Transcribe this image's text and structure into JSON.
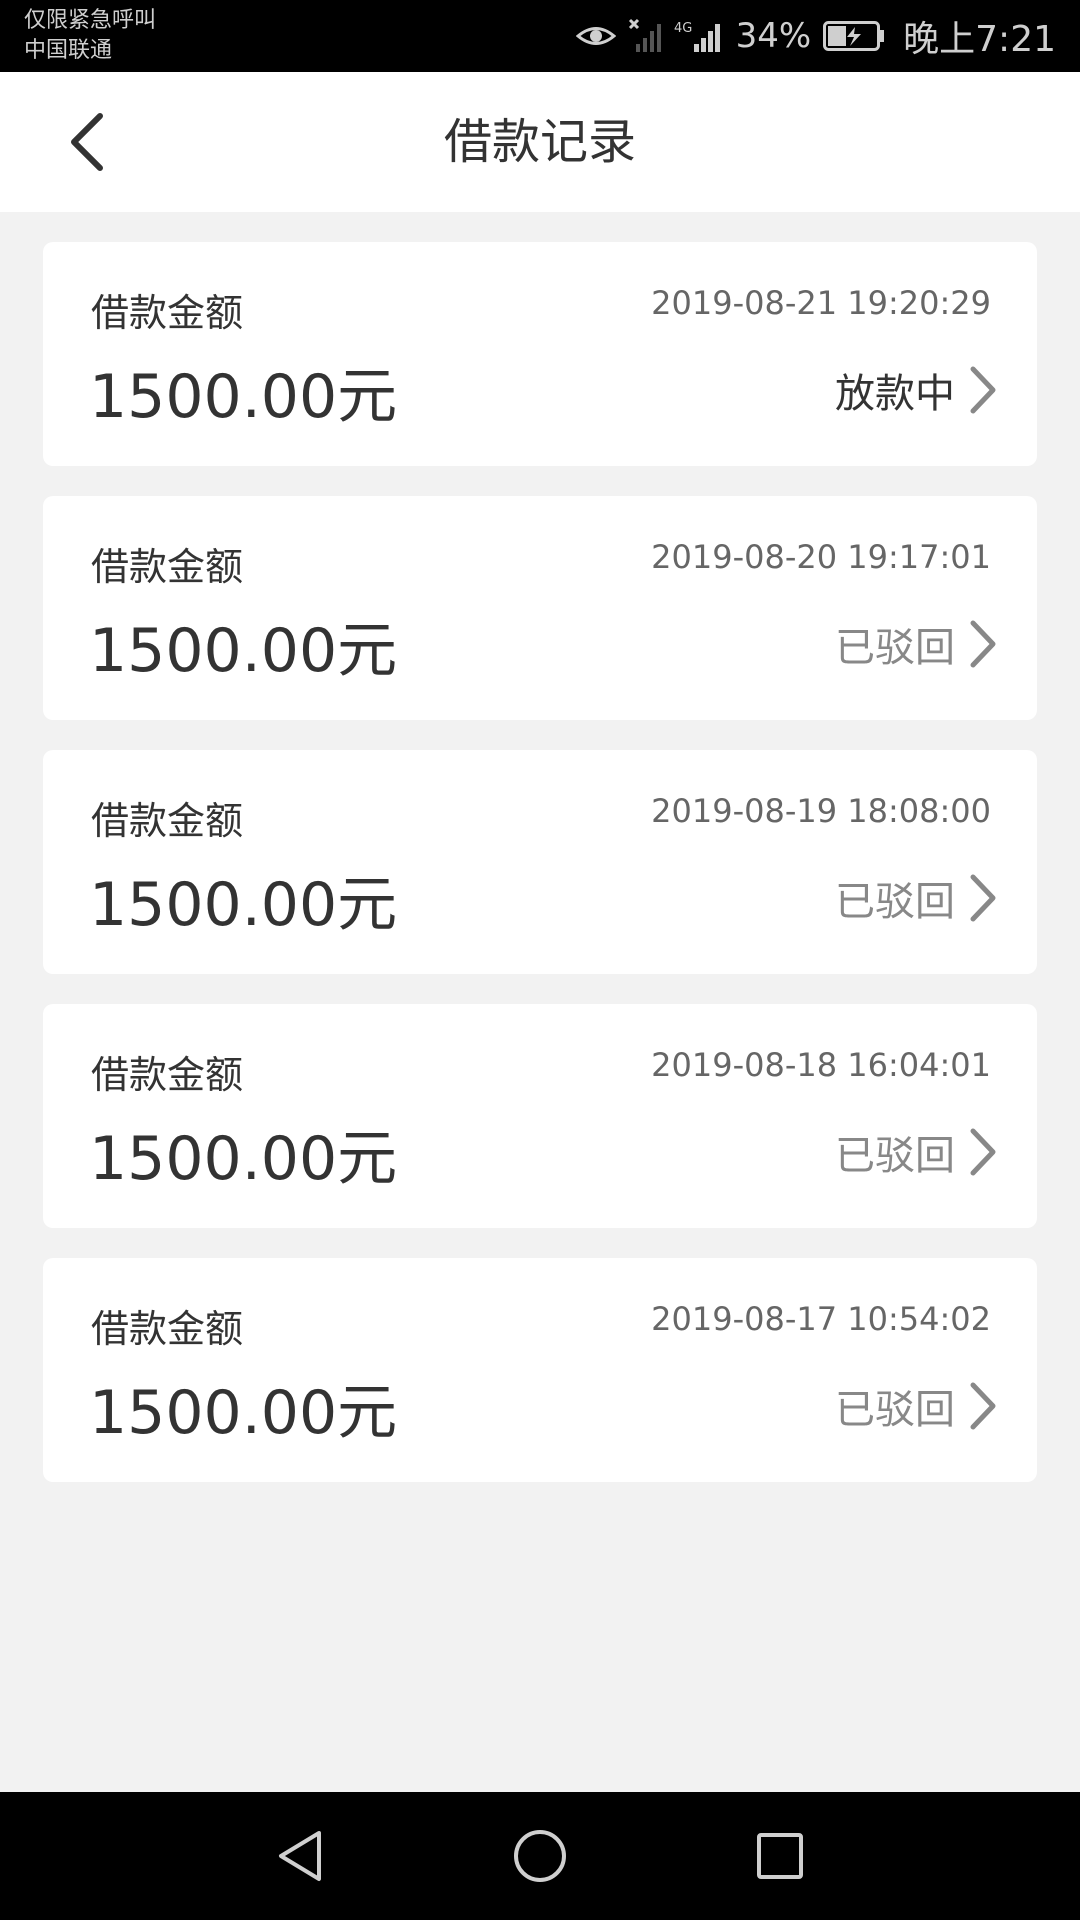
{
  "status_bar": {
    "carrier_line1": "仅限紧急呼叫",
    "carrier_line2": "中国联通",
    "network": "4G",
    "battery_percent": "34%",
    "time": "晚上7:21"
  },
  "header": {
    "title": "借款记录"
  },
  "records": [
    {
      "label": "借款金额",
      "date": "2019-08-21 19:20:29",
      "amount": "1500.00元",
      "status": "放款中"
    },
    {
      "label": "借款金额",
      "date": "2019-08-20 19:17:01",
      "amount": "1500.00元",
      "status": "已驳回"
    },
    {
      "label": "借款金额",
      "date": "2019-08-19 18:08:00",
      "amount": "1500.00元",
      "status": "已驳回"
    },
    {
      "label": "借款金额",
      "date": "2019-08-18 16:04:01",
      "amount": "1500.00元",
      "status": "已驳回"
    },
    {
      "label": "借款金额",
      "date": "2019-08-17 10:54:02",
      "amount": "1500.00元",
      "status": "已驳回"
    }
  ],
  "colors": {
    "background": "#f2f2f2",
    "card": "#ffffff",
    "text_primary": "#333333",
    "text_secondary": "#888888"
  },
  "icons": {
    "back": "chevron-left-icon",
    "row_arrow": "chevron-right-icon",
    "nav_back": "triangle-back-icon",
    "nav_home": "circle-home-icon",
    "nav_recents": "square-recents-icon"
  }
}
